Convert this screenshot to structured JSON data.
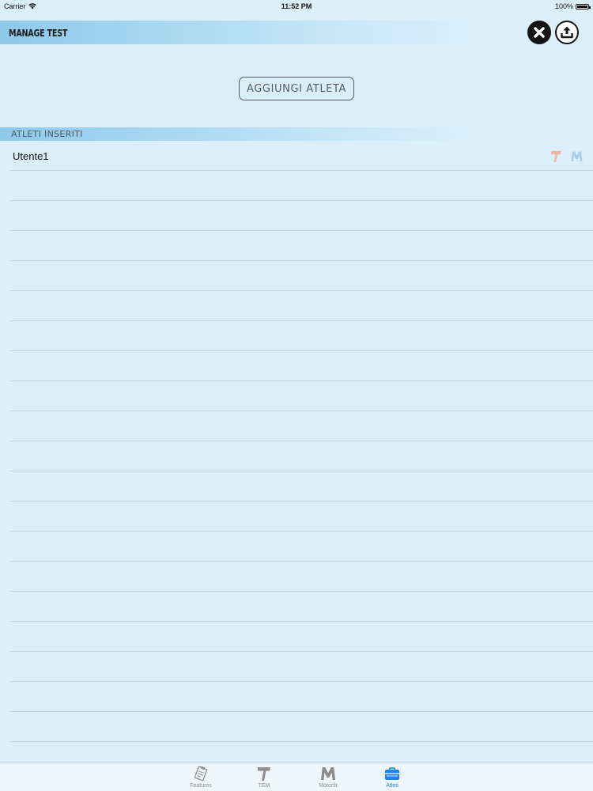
{
  "status_bar": {
    "carrier": "Carrier",
    "time": "11:52 PM",
    "battery": "100%"
  },
  "header": {
    "title": "MANAGE TEST"
  },
  "actions": {
    "add_athlete_label": "AGGIUNGI ATLETA"
  },
  "section": {
    "title": "ATLETI INSERITI"
  },
  "athletes": [
    {
      "name": "Utente1",
      "icons": [
        "tem-icon",
        "motorfit-icon"
      ]
    }
  ],
  "tabs": [
    {
      "label": "Features",
      "icon": "clipboard-icon",
      "active": false
    },
    {
      "label": "TEM",
      "icon": "tem-icon",
      "active": false
    },
    {
      "label": "Motorfit",
      "icon": "motorfit-icon",
      "active": false
    },
    {
      "label": "Atleti",
      "icon": "briefcase-icon",
      "active": true
    }
  ],
  "colors": {
    "background": "#dbeffb",
    "header_gradient": "#8ec9ea",
    "active_tab": "#1a84e8",
    "inactive_tab": "#8d8d8d"
  }
}
